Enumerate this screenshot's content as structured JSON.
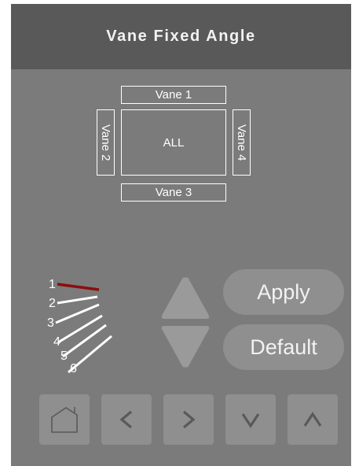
{
  "title": "Vane Fixed Angle",
  "vanes": {
    "vane1": "Vane 1",
    "vane2": "Vane 2",
    "vane3": "Vane 3",
    "vane4": "Vane 4",
    "all": "ALL"
  },
  "angle": {
    "positions": [
      "1",
      "2",
      "3",
      "4",
      "5",
      "6"
    ],
    "selected": "1",
    "selected_color": "#8b0d0d"
  },
  "buttons": {
    "apply": "Apply",
    "default": "Default"
  },
  "nav": {
    "home_icon": "home-icon",
    "left_label": "<",
    "right_label": ">",
    "down_label": "V",
    "up_label": "Λ"
  }
}
